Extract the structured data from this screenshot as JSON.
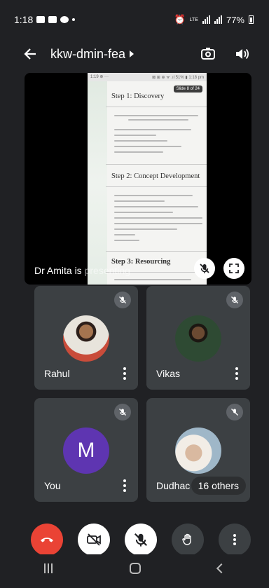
{
  "status_bar": {
    "time": "1:18",
    "battery": "77%",
    "network": "LTE"
  },
  "header": {
    "meeting_title": "kkw-dmin-fea",
    "icons": [
      "back-arrow-icon",
      "switch-camera-icon",
      "speaker-icon"
    ]
  },
  "presentation": {
    "presenter_name_text": "Dr Amita is ",
    "presenter_suffix_text": "presenting",
    "slide": {
      "status_left": "1:19 ⊕ ···",
      "status_right": "⊠ ⊞ ⊕ ᯤ .ıl 51% ▮ 1:18 pm",
      "badge": "Slide 8 of 24",
      "headings": [
        "Step 1: Discovery",
        "Step 2: Concept Development",
        "Step 3: Resourcing"
      ]
    }
  },
  "participants": [
    {
      "name": "Rahul",
      "avatar_type": "photo",
      "muted": true
    },
    {
      "name": "Vikas",
      "avatar_type": "photo",
      "muted": true
    },
    {
      "name": "You",
      "avatar_type": "letter",
      "avatar_letter": "M",
      "avatar_color": "#5e35b1",
      "muted": true
    },
    {
      "name": "Dudhac",
      "avatar_type": "photo",
      "muted": true,
      "overflow_label": "16 others"
    }
  ],
  "controls": [
    "end-call-icon",
    "camera-off-icon",
    "mic-off-icon",
    "raise-hand-icon",
    "more-options-icon"
  ],
  "colors": {
    "background": "#202124",
    "tile": "#3c4043",
    "end_call": "#ea4335",
    "avatar_m": "#5e35b1"
  }
}
